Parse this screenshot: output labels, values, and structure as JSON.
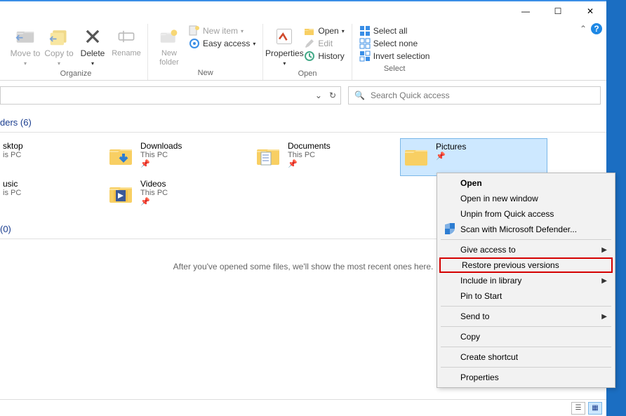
{
  "caption": {
    "min": "—",
    "max": "☐",
    "close": "✕",
    "help": "?"
  },
  "ribbon": {
    "groups": {
      "organize": {
        "label": "Organize",
        "move": "Move to",
        "copy": "Copy to",
        "delete": "Delete",
        "rename": "Rename"
      },
      "new": {
        "label": "New",
        "newfolder": "New folder",
        "newitem": "New item",
        "easy": "Easy access"
      },
      "open": {
        "label": "Open",
        "properties": "Properties",
        "open": "Open",
        "edit": "Edit",
        "history": "History"
      },
      "select": {
        "label": "Select",
        "all": "Select all",
        "none": "Select none",
        "invert": "Invert selection"
      }
    }
  },
  "search": {
    "placeholder": "Search Quick access"
  },
  "sections": {
    "folders_header": "ders (6)",
    "recent_header": "(0)",
    "recent_hint": "After you've opened some files, we'll show the most recent ones here."
  },
  "folders": [
    {
      "name": "sktop",
      "sub": "is PC",
      "small_left": true
    },
    {
      "name": "Downloads",
      "sub": "This PC",
      "icon": "down"
    },
    {
      "name": "Documents",
      "sub": "This PC",
      "icon": "doc"
    },
    {
      "name": "Pictures",
      "sub": "",
      "icon": "plain",
      "selected": true
    },
    {
      "name": "usic",
      "sub": "is PC",
      "small_left": true
    },
    {
      "name": "Videos",
      "sub": "This PC",
      "icon": "vid"
    }
  ],
  "contextmenu": [
    {
      "t": "item",
      "label": "Open",
      "bold": true
    },
    {
      "t": "item",
      "label": "Open in new window"
    },
    {
      "t": "item",
      "label": "Unpin from Quick access"
    },
    {
      "t": "item",
      "label": "Scan with Microsoft Defender...",
      "icon": "shield"
    },
    {
      "t": "sep"
    },
    {
      "t": "item",
      "label": "Give access to",
      "arrow": true
    },
    {
      "t": "item",
      "label": "Restore previous versions",
      "highlight": true
    },
    {
      "t": "item",
      "label": "Include in library",
      "arrow": true
    },
    {
      "t": "item",
      "label": "Pin to Start"
    },
    {
      "t": "sep"
    },
    {
      "t": "item",
      "label": "Send to",
      "arrow": true
    },
    {
      "t": "sep"
    },
    {
      "t": "item",
      "label": "Copy"
    },
    {
      "t": "sep"
    },
    {
      "t": "item",
      "label": "Create shortcut"
    },
    {
      "t": "sep"
    },
    {
      "t": "item",
      "label": "Properties"
    }
  ]
}
